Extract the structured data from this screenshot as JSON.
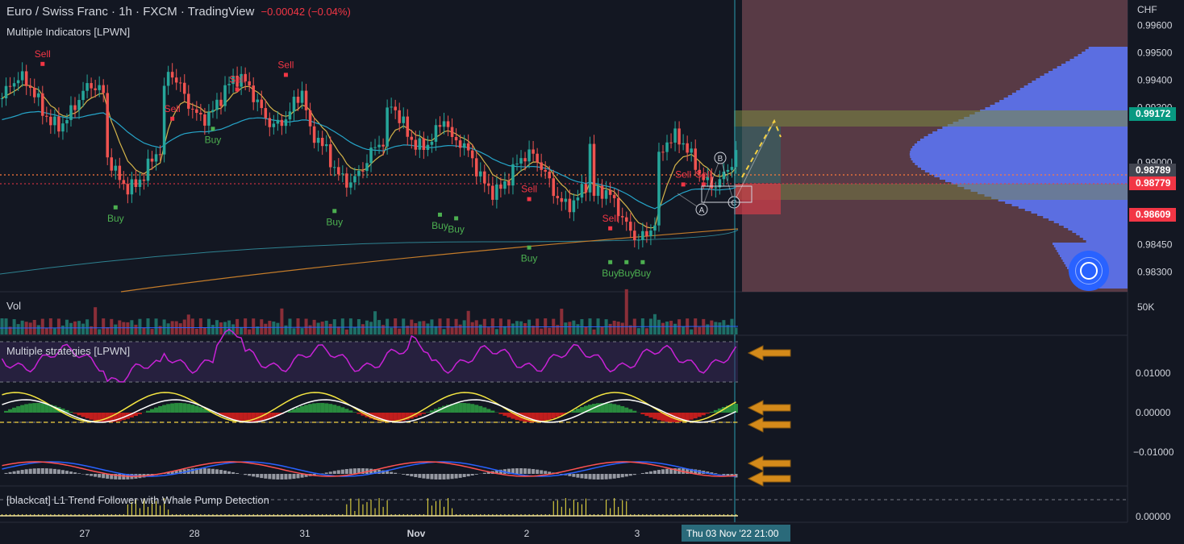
{
  "header": {
    "title": "Euro / Swiss Franc · 1h · FXCM · TradingView",
    "change": "−0.00042 (−0.04%)",
    "indicator": "Multiple Indicators [LPWN]"
  },
  "currency": "CHF",
  "colors": {
    "bg": "#131722",
    "up": "#26a69a",
    "down": "#ef5350",
    "grid": "#2a2e39",
    "profile": "#5b6ee1",
    "ema_fast": "#d4b44a",
    "ema_mid": "#26a5c9",
    "ema_slow": "#c47c2a",
    "rsi": "#c822d6",
    "arrow": "#d48a1a"
  },
  "chart_data": [
    {
      "type": "candlestick",
      "title": "Euro / Swiss Franc · 1h · FXCM · TradingView",
      "ylabel": "CHF",
      "ylim": [
        0.982,
        0.997
      ],
      "y_ticks": [
        0.983,
        0.9845,
        0.986,
        0.9875,
        0.989,
        0.9905,
        0.992,
        0.9935,
        0.995,
        0.9965
      ],
      "y_tick_labels": [
        "0.98300",
        "0.98450",
        "0.98609",
        "0.98789",
        "0.99000",
        "0.99172",
        "0.99300",
        "0.99400",
        "0.99500",
        "0.99600"
      ],
      "x_ticks": [
        "27",
        "28",
        "31",
        "Nov",
        "2",
        "3"
      ],
      "price_tags": [
        {
          "label": "0.99172",
          "value": 0.99172,
          "color": "#089981"
        },
        {
          "label": "0.98789",
          "value": 0.98789,
          "color": "#434651"
        },
        {
          "label": "0.98779",
          "value": 0.98779,
          "color": "#f23645"
        },
        {
          "label": "0.98609",
          "value": 0.98609,
          "color": "#f23645"
        }
      ],
      "signals": [
        {
          "label": "Sell",
          "index": 10,
          "value": 0.9952
        },
        {
          "label": "Buy",
          "index": 28,
          "value": 0.9862
        },
        {
          "label": "Sell",
          "index": 42,
          "value": 0.9922
        },
        {
          "label": "Buy",
          "index": 52,
          "value": 0.9905
        },
        {
          "label": "Sell",
          "index": 58,
          "value": 0.9938
        },
        {
          "label": "Sell",
          "index": 70,
          "value": 0.9946
        },
        {
          "label": "Buy",
          "index": 82,
          "value": 0.986
        },
        {
          "label": "Buy",
          "index": 108,
          "value": 0.9858
        },
        {
          "label": "Buy",
          "index": 112,
          "value": 0.9856
        },
        {
          "label": "Sell",
          "index": 130,
          "value": 0.9878
        },
        {
          "label": "Buy",
          "index": 130,
          "value": 0.984
        },
        {
          "label": "Sell",
          "index": 150,
          "value": 0.9862
        },
        {
          "label": "Buy",
          "index": 150,
          "value": 0.9832
        },
        {
          "label": "Buy",
          "index": 154,
          "value": 0.9832
        },
        {
          "label": "Buy",
          "index": 158,
          "value": 0.9832
        },
        {
          "label": "Sell",
          "index": 168,
          "value": 0.9886
        },
        {
          "label": "Sell",
          "index": 173,
          "value": 0.9886
        }
      ],
      "pattern_points": [
        "A",
        "B",
        "C"
      ],
      "crosshair_time": "Thu 03 Nov '22   21:00"
    },
    {
      "type": "bar",
      "title": "Vol",
      "y_tick_labels": [
        "50K"
      ]
    },
    {
      "type": "line",
      "title": "Multiple strategies [LPWN]",
      "y_tick_labels": [
        "0.01000",
        "0.00000",
        "−0.01000"
      ]
    },
    {
      "type": "bar",
      "title": "[blackcat] L1 Trend Follower with Whale Pump Detection",
      "y_tick_labels": [
        "0.00000"
      ]
    }
  ]
}
